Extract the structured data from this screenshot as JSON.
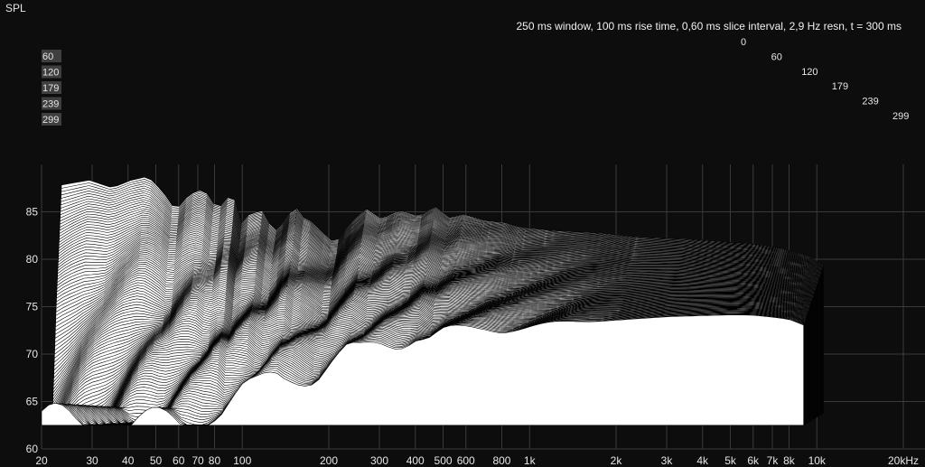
{
  "chart_data": {
    "type": "area",
    "subtype": "waterfall (cumulative spectral decay)",
    "ylabel": "SPL",
    "info": "250 ms window, 100 ms rise time, 0,60 ms slice interval, 2,9 Hz resn, t = 300 ms",
    "x_scale": "log",
    "xlim": [
      20,
      20000
    ],
    "ylim": [
      60,
      90
    ],
    "y_ticks": [
      "60",
      "65",
      "70",
      "75",
      "80",
      "85"
    ],
    "y_tick_values": [
      60,
      65,
      70,
      75,
      80,
      85
    ],
    "x_ticks": [
      "20",
      "30",
      "40",
      "50",
      "60",
      "70",
      "80",
      "100",
      "200",
      "300",
      "400",
      "500",
      "600",
      "800",
      "1k",
      "2k",
      "3k",
      "4k",
      "5k",
      "6k",
      "7k",
      "8k",
      "10k",
      "20kHz"
    ],
    "x_tick_values": [
      20,
      30,
      40,
      50,
      60,
      70,
      80,
      100,
      200,
      300,
      400,
      500,
      600,
      800,
      1000,
      2000,
      3000,
      4000,
      5000,
      6000,
      7000,
      8000,
      10000,
      20000
    ],
    "time_slices_ms": [
      "0",
      "60",
      "120",
      "179",
      "239",
      "299"
    ],
    "time_slice_values": [
      0,
      60,
      120,
      179,
      239,
      299
    ],
    "front_slice_response": {
      "freq_hz": [
        20,
        25,
        30,
        35,
        40,
        45,
        50,
        55,
        60,
        65,
        70,
        75,
        80,
        85,
        90,
        100,
        110,
        120,
        130,
        140,
        150,
        160,
        180,
        200,
        230,
        260,
        300,
        350,
        400,
        450,
        500,
        600,
        700,
        800,
        1000,
        1500,
        2000,
        3000,
        4000,
        5000,
        6000,
        7000,
        8000,
        9000
      ],
      "spl_db": [
        86.5,
        87.0,
        86.2,
        87.0,
        87.4,
        85.8,
        83.8,
        85.3,
        86.0,
        85.5,
        83.8,
        85.2,
        85.0,
        82.3,
        83.4,
        83.8,
        81.5,
        82.7,
        84.3,
        83.0,
        82.6,
        81.6,
        80.3,
        82.3,
        84.0,
        82.9,
        83.8,
        83.2,
        84.2,
        83.0,
        83.4,
        82.7,
        82.5,
        82.0,
        81.7,
        81.4,
        81.0,
        80.8,
        80.5,
        80.3,
        80.0,
        79.5,
        79.0,
        78.0
      ]
    },
    "floor_spl_db": 62.5,
    "grid": true,
    "colors": {
      "background": "#0d0d0d",
      "surface": "#ffffff",
      "lines": "#000000",
      "grid": "#3a3a3a",
      "text": "#e6e6e6"
    }
  }
}
